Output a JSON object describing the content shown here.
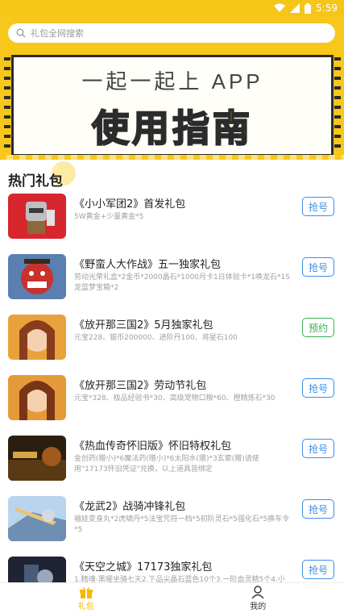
{
  "status_bar": {
    "time": "5:59"
  },
  "search": {
    "placeholder": "礼包全网搜索"
  },
  "banner": {
    "line1": "一起一起上 APP",
    "line2": "使用指南"
  },
  "section": {
    "title": "热门礼包"
  },
  "gifts": [
    {
      "name": "《小小军团2》首发礼包",
      "desc": "5W黄金+少量黄金*5",
      "button": "抢号",
      "button_type": "grab"
    },
    {
      "name": "《野蛮人大作战》五一独家礼包",
      "desc": "劳动光荣礼盒*2金币*2000晶石*1000月卡1日体验卡*1唤龙石*1S龙蓝梦宝箱*2",
      "button": "抢号",
      "button_type": "grab"
    },
    {
      "name": "《放开那三国2》5月独家礼包",
      "desc": "元宝228、银币200000、进阶丹100、将星石100",
      "button": "预约",
      "button_type": "reserve"
    },
    {
      "name": "《放开那三国2》劳动节礼包",
      "desc": "元宝*328、极品经验书*30、高级宠物口粮*60、橙精炼石*30",
      "button": "抢号",
      "button_type": "grab"
    },
    {
      "name": "《热血传奇怀旧版》怀旧特权礼包",
      "desc": "金创药(赠小)*6魔法药(赠小)*6太阳水(赠)*3玄索(赠)请使用\"17173怀旧凭证\"兑换，以上道具皆绑定",
      "button": "抢号",
      "button_type": "grab"
    },
    {
      "name": "《龙武2》战骑冲锋礼包",
      "desc": "福娃变身丸*2虎啸丹*5法宝咒符一档*5初阶灵石*5强化石*5换车令*5",
      "button": "抢号",
      "button_type": "grab"
    },
    {
      "name": "《天空之城》17173独家礼包",
      "desc": "1.精魂-黑曜坐骑七天2.下品尖晶石蓝色10个3.一阶血灵精5个4.小型",
      "button": "抢号",
      "button_type": "grab"
    }
  ],
  "tabs": [
    {
      "label": "礼包",
      "icon": "gift-icon",
      "active": true
    },
    {
      "label": "我的",
      "icon": "user-icon",
      "active": false
    }
  ],
  "colors": {
    "brand": "#f7c71c",
    "button_blue": "#3a8ee6",
    "button_green": "#37b24d"
  }
}
